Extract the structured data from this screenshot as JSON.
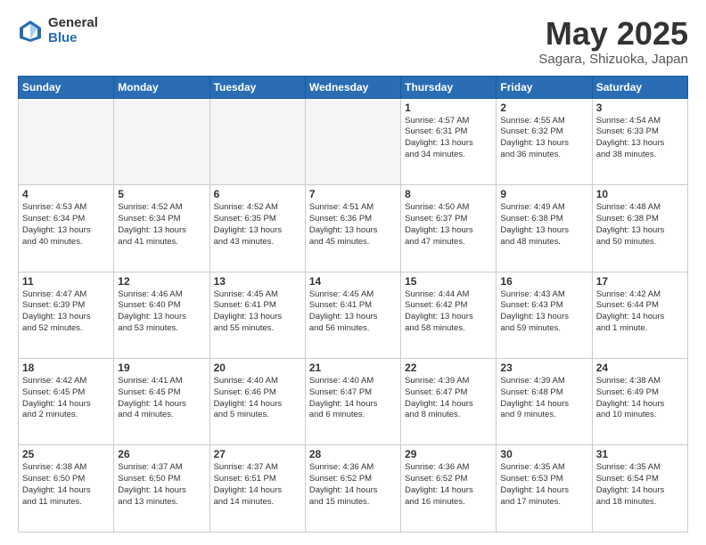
{
  "header": {
    "logo_general": "General",
    "logo_blue": "Blue",
    "month_title": "May 2025",
    "subtitle": "Sagara, Shizuoka, Japan"
  },
  "days_of_week": [
    "Sunday",
    "Monday",
    "Tuesday",
    "Wednesday",
    "Thursday",
    "Friday",
    "Saturday"
  ],
  "weeks": [
    [
      {
        "day": "",
        "info": ""
      },
      {
        "day": "",
        "info": ""
      },
      {
        "day": "",
        "info": ""
      },
      {
        "day": "",
        "info": ""
      },
      {
        "day": "1",
        "info": "Sunrise: 4:57 AM\nSunset: 6:31 PM\nDaylight: 13 hours\nand 34 minutes."
      },
      {
        "day": "2",
        "info": "Sunrise: 4:55 AM\nSunset: 6:32 PM\nDaylight: 13 hours\nand 36 minutes."
      },
      {
        "day": "3",
        "info": "Sunrise: 4:54 AM\nSunset: 6:33 PM\nDaylight: 13 hours\nand 38 minutes."
      }
    ],
    [
      {
        "day": "4",
        "info": "Sunrise: 4:53 AM\nSunset: 6:34 PM\nDaylight: 13 hours\nand 40 minutes."
      },
      {
        "day": "5",
        "info": "Sunrise: 4:52 AM\nSunset: 6:34 PM\nDaylight: 13 hours\nand 41 minutes."
      },
      {
        "day": "6",
        "info": "Sunrise: 4:52 AM\nSunset: 6:35 PM\nDaylight: 13 hours\nand 43 minutes."
      },
      {
        "day": "7",
        "info": "Sunrise: 4:51 AM\nSunset: 6:36 PM\nDaylight: 13 hours\nand 45 minutes."
      },
      {
        "day": "8",
        "info": "Sunrise: 4:50 AM\nSunset: 6:37 PM\nDaylight: 13 hours\nand 47 minutes."
      },
      {
        "day": "9",
        "info": "Sunrise: 4:49 AM\nSunset: 6:38 PM\nDaylight: 13 hours\nand 48 minutes."
      },
      {
        "day": "10",
        "info": "Sunrise: 4:48 AM\nSunset: 6:38 PM\nDaylight: 13 hours\nand 50 minutes."
      }
    ],
    [
      {
        "day": "11",
        "info": "Sunrise: 4:47 AM\nSunset: 6:39 PM\nDaylight: 13 hours\nand 52 minutes."
      },
      {
        "day": "12",
        "info": "Sunrise: 4:46 AM\nSunset: 6:40 PM\nDaylight: 13 hours\nand 53 minutes."
      },
      {
        "day": "13",
        "info": "Sunrise: 4:45 AM\nSunset: 6:41 PM\nDaylight: 13 hours\nand 55 minutes."
      },
      {
        "day": "14",
        "info": "Sunrise: 4:45 AM\nSunset: 6:41 PM\nDaylight: 13 hours\nand 56 minutes."
      },
      {
        "day": "15",
        "info": "Sunrise: 4:44 AM\nSunset: 6:42 PM\nDaylight: 13 hours\nand 58 minutes."
      },
      {
        "day": "16",
        "info": "Sunrise: 4:43 AM\nSunset: 6:43 PM\nDaylight: 13 hours\nand 59 minutes."
      },
      {
        "day": "17",
        "info": "Sunrise: 4:42 AM\nSunset: 6:44 PM\nDaylight: 14 hours\nand 1 minute."
      }
    ],
    [
      {
        "day": "18",
        "info": "Sunrise: 4:42 AM\nSunset: 6:45 PM\nDaylight: 14 hours\nand 2 minutes."
      },
      {
        "day": "19",
        "info": "Sunrise: 4:41 AM\nSunset: 6:45 PM\nDaylight: 14 hours\nand 4 minutes."
      },
      {
        "day": "20",
        "info": "Sunrise: 4:40 AM\nSunset: 6:46 PM\nDaylight: 14 hours\nand 5 minutes."
      },
      {
        "day": "21",
        "info": "Sunrise: 4:40 AM\nSunset: 6:47 PM\nDaylight: 14 hours\nand 6 minutes."
      },
      {
        "day": "22",
        "info": "Sunrise: 4:39 AM\nSunset: 6:47 PM\nDaylight: 14 hours\nand 8 minutes."
      },
      {
        "day": "23",
        "info": "Sunrise: 4:39 AM\nSunset: 6:48 PM\nDaylight: 14 hours\nand 9 minutes."
      },
      {
        "day": "24",
        "info": "Sunrise: 4:38 AM\nSunset: 6:49 PM\nDaylight: 14 hours\nand 10 minutes."
      }
    ],
    [
      {
        "day": "25",
        "info": "Sunrise: 4:38 AM\nSunset: 6:50 PM\nDaylight: 14 hours\nand 11 minutes."
      },
      {
        "day": "26",
        "info": "Sunrise: 4:37 AM\nSunset: 6:50 PM\nDaylight: 14 hours\nand 13 minutes."
      },
      {
        "day": "27",
        "info": "Sunrise: 4:37 AM\nSunset: 6:51 PM\nDaylight: 14 hours\nand 14 minutes."
      },
      {
        "day": "28",
        "info": "Sunrise: 4:36 AM\nSunset: 6:52 PM\nDaylight: 14 hours\nand 15 minutes."
      },
      {
        "day": "29",
        "info": "Sunrise: 4:36 AM\nSunset: 6:52 PM\nDaylight: 14 hours\nand 16 minutes."
      },
      {
        "day": "30",
        "info": "Sunrise: 4:35 AM\nSunset: 6:53 PM\nDaylight: 14 hours\nand 17 minutes."
      },
      {
        "day": "31",
        "info": "Sunrise: 4:35 AM\nSunset: 6:54 PM\nDaylight: 14 hours\nand 18 minutes."
      }
    ]
  ]
}
